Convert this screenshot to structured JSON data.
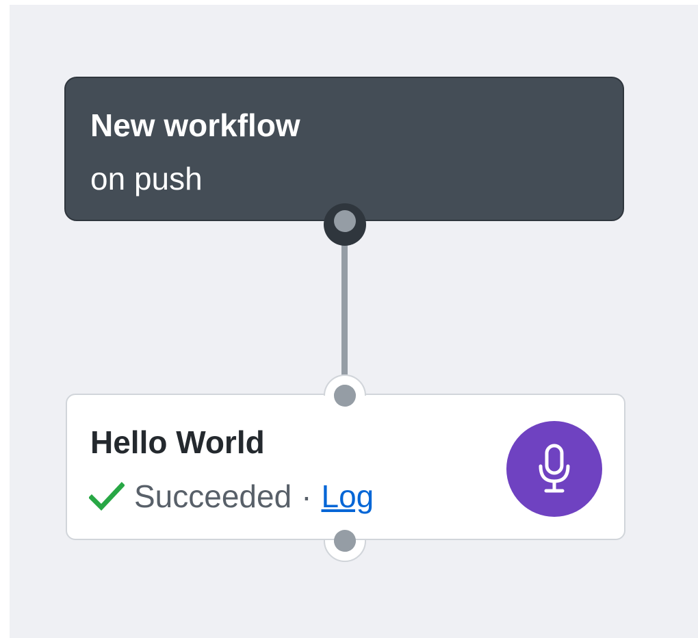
{
  "trigger": {
    "title": "New workflow",
    "subtitle": "on push"
  },
  "action": {
    "title": "Hello World",
    "status": "Succeeded",
    "separator": "·",
    "log_label": "Log",
    "status_icon": "check-icon",
    "action_icon": "microphone-icon"
  },
  "colors": {
    "canvas": "#eff0f4",
    "trigger_bg": "#444d56",
    "success": "#28a745",
    "link": "#0366d6",
    "action_icon_bg": "#6f42c1",
    "connector": "#959da5"
  }
}
